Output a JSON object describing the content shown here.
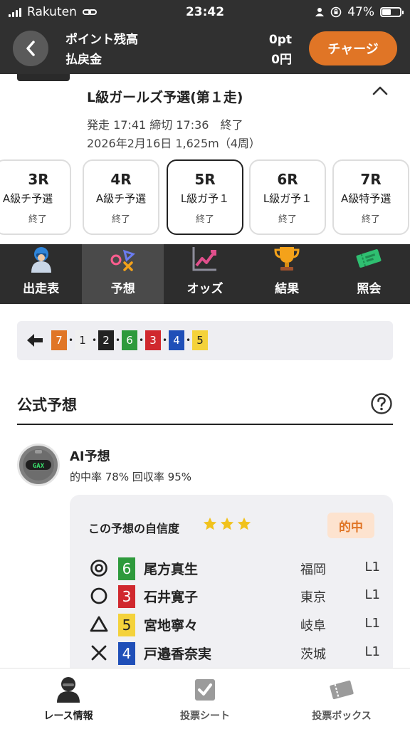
{
  "status_bar": {
    "carrier": "Rakuten",
    "time": "23:42",
    "battery": "47%"
  },
  "header": {
    "points_label": "ポイント残高",
    "points_value": "0pt",
    "refund_label": "払戻金",
    "refund_value": "0円",
    "charge_button": "チャージ"
  },
  "race": {
    "title": "L級ガールズ予選(第１走)",
    "time_info": "発走 17:41 締切 17:36　終了",
    "date_info": "2026年2月16日 1,625m（4周）"
  },
  "race_tabs": [
    {
      "num": "3R",
      "name": "A級チ予選",
      "status": "終了"
    },
    {
      "num": "4R",
      "name": "A級チ予選",
      "status": "終了"
    },
    {
      "num": "5R",
      "name": "L級ガ予１",
      "status": "終了"
    },
    {
      "num": "6R",
      "name": "L級ガ予１",
      "status": "終了"
    },
    {
      "num": "7R",
      "name": "A級特予選",
      "status": "終了"
    }
  ],
  "nav": [
    {
      "label": "出走表",
      "icon": "rider-icon"
    },
    {
      "label": "予想",
      "icon": "prediction-icon"
    },
    {
      "label": "オッズ",
      "icon": "odds-chart-icon"
    },
    {
      "label": "結果",
      "icon": "trophy-icon"
    },
    {
      "label": "照会",
      "icon": "ticket-icon"
    }
  ],
  "result_order": {
    "numbers": [
      "7",
      "1",
      "2",
      "6",
      "3",
      "4",
      "5"
    ],
    "colors": {
      "1": {
        "bg": "#f0f0f0",
        "fg": "#222222"
      },
      "2": {
        "bg": "#222222",
        "fg": "#ffffff"
      },
      "3": {
        "bg": "#d0282e",
        "fg": "#ffffff"
      },
      "4": {
        "bg": "#1f4fb8",
        "fg": "#ffffff"
      },
      "5": {
        "bg": "#f4d23b",
        "fg": "#222222"
      },
      "6": {
        "bg": "#2e9a3c",
        "fg": "#ffffff"
      },
      "7": {
        "bg": "#e07526",
        "fg": "#ffffff"
      }
    }
  },
  "official": {
    "section_title": "公式予想",
    "ai_name": "AI予想",
    "ai_stats": "的中率 78%  回収率 95%",
    "confidence_label": "この予想の自信度",
    "confidence_stars": 3,
    "hit_badge": "的中",
    "picks": [
      {
        "mark": "double-circle",
        "num": "6",
        "name": "尾方真生",
        "pref": "福岡",
        "cls": "L1"
      },
      {
        "mark": "circle",
        "num": "3",
        "name": "石井寛子",
        "pref": "東京",
        "cls": "L1"
      },
      {
        "mark": "triangle",
        "num": "5",
        "name": "宮地寧々",
        "pref": "岐阜",
        "cls": "L1"
      },
      {
        "mark": "cross",
        "num": "4",
        "name": "戸邉香奈実",
        "pref": "茨城",
        "cls": "L1"
      }
    ]
  },
  "tabbar": [
    {
      "label": "レース情報",
      "icon": "race-info-icon"
    },
    {
      "label": "投票シート",
      "icon": "vote-sheet-icon"
    },
    {
      "label": "投票ボックス",
      "icon": "vote-box-icon"
    }
  ],
  "accent_color": "#e07526"
}
